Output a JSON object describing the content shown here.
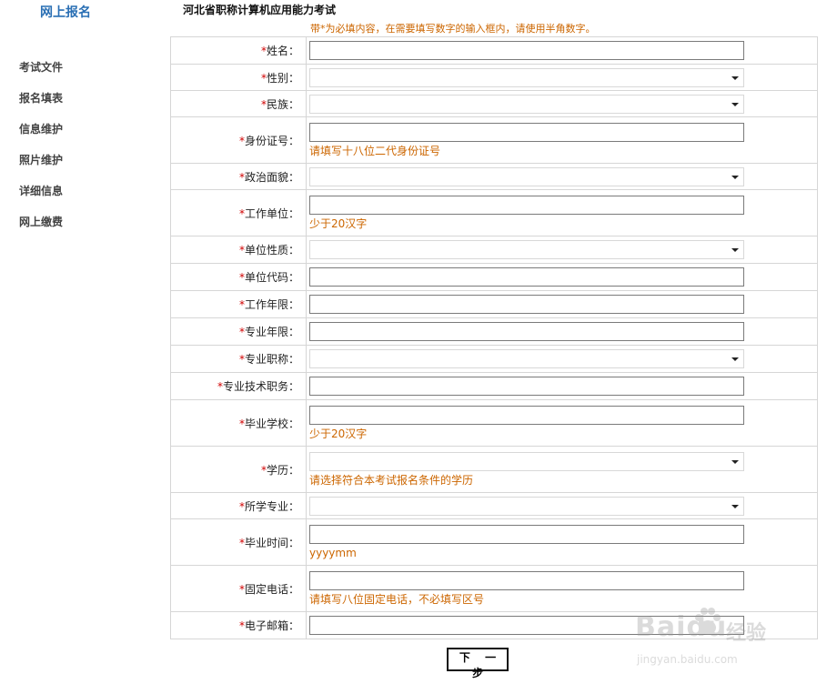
{
  "sidebar": {
    "brand": "网上报名",
    "items": [
      {
        "label": "考试文件"
      },
      {
        "label": "报名填表"
      },
      {
        "label": "信息维护"
      },
      {
        "label": "照片维护"
      },
      {
        "label": "详细信息"
      },
      {
        "label": "网上缴费"
      }
    ]
  },
  "page": {
    "title": "河北省职称计算机应用能力考试",
    "notice": "带*为必填内容，在需要填写数字的输入框内，请使用半角数字。"
  },
  "form": {
    "required_mark": "*",
    "fields": [
      {
        "label": "姓名：",
        "value": ""
      },
      {
        "label": "性别：",
        "value": ""
      },
      {
        "label": "民族：",
        "value": ""
      },
      {
        "label": "身份证号：",
        "value": "",
        "hint": "请填写十八位二代身份证号"
      },
      {
        "label": "政治面貌：",
        "value": ""
      },
      {
        "label": "工作单位：",
        "value": "",
        "hint": "少于20汉字"
      },
      {
        "label": "单位性质：",
        "value": ""
      },
      {
        "label": "单位代码：",
        "value": ""
      },
      {
        "label": "工作年限：",
        "value": ""
      },
      {
        "label": "专业年限：",
        "value": ""
      },
      {
        "label": "专业职称：",
        "value": ""
      },
      {
        "label": "专业技术职务：",
        "value": ""
      },
      {
        "label": "毕业学校：",
        "value": "",
        "hint": "少于20汉字"
      },
      {
        "label": "学历：",
        "value": "",
        "hint": "请选择符合本考试报名条件的学历"
      },
      {
        "label": "所学专业：",
        "value": ""
      },
      {
        "label": "毕业时间：",
        "value": "",
        "hint": "yyyymm"
      },
      {
        "label": "固定电话：",
        "value": "",
        "hint": "请填写八位固定电话，不必填写区号"
      },
      {
        "label": "电子邮箱：",
        "value": ""
      }
    ],
    "next_button": "下 一 步"
  },
  "watermark": {
    "brand": "Baidu",
    "brand_cn": "经验",
    "site": "jingyan.baidu.com"
  }
}
